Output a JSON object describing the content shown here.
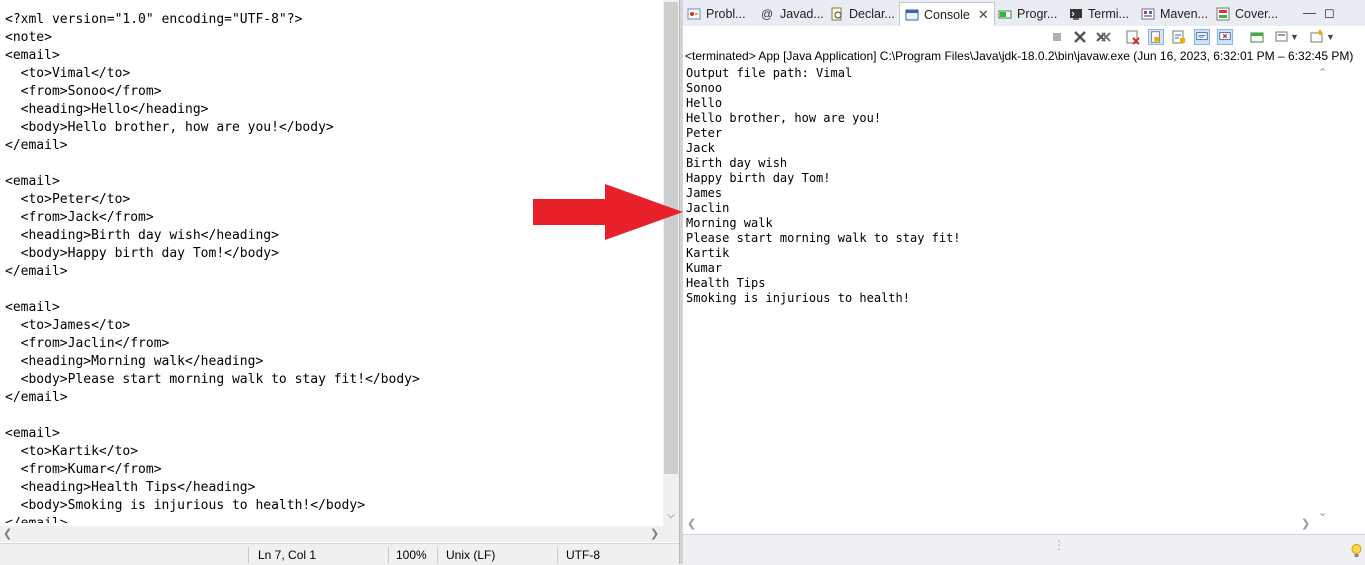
{
  "editor": {
    "lines": [
      "<?xml version=\"1.0\" encoding=\"UTF-8\"?>",
      "<note>",
      "<email>",
      "  <to>Vimal</to>",
      "  <from>Sonoo</from>",
      "  <heading>Hello</heading>",
      "  <body>Hello brother, how are you!</body>",
      "</email>",
      "",
      "<email>",
      "  <to>Peter</to>",
      "  <from>Jack</from>",
      "  <heading>Birth day wish</heading>",
      "  <body>Happy birth day Tom!</body>",
      "</email>",
      "",
      "<email>",
      "  <to>James</to>",
      "  <from>Jaclin</from>",
      "  <heading>Morning walk</heading>",
      "  <body>Please start morning walk to stay fit!</body>",
      "</email>",
      "",
      "<email>",
      "  <to>Kartik</to>",
      "  <from>Kumar</from>",
      "  <heading>Health Tips</heading>",
      "  <body>Smoking is injurious to health!</body>",
      "</email>"
    ],
    "status": {
      "position": "Ln 7, Col 1",
      "zoom": "100%",
      "line_ending": "Unix (LF)",
      "encoding": "UTF-8"
    }
  },
  "eclipse": {
    "tabs": [
      {
        "label": "Probl...",
        "icon": "problems-icon"
      },
      {
        "label": "Javad...",
        "icon": "javadoc-icon"
      },
      {
        "label": "Declar...",
        "icon": "declaration-icon"
      },
      {
        "label": "Console",
        "icon": "console-icon",
        "active": true
      },
      {
        "label": "Progr...",
        "icon": "progress-icon"
      },
      {
        "label": "Termi...",
        "icon": "terminal-icon"
      },
      {
        "label": "Maven...",
        "icon": "maven-icon"
      },
      {
        "label": "Cover...",
        "icon": "coverage-icon"
      }
    ],
    "console_header": "<terminated> App [Java Application] C:\\Program Files\\Java\\jdk-18.0.2\\bin\\javaw.exe  (Jun 16, 2023, 6:32:01 PM – 6:32:45 PM)",
    "output_lines": [
      "Output file path: Vimal",
      "Sonoo",
      "Hello",
      "Hello brother, how are you!",
      "Peter",
      "Jack",
      "Birth day wish",
      "Happy birth day Tom!",
      "James",
      "Jaclin",
      "Morning walk",
      "Please start morning walk to stay fit!",
      "Kartik",
      "Kumar",
      "Health Tips",
      "Smoking is injurious to health!"
    ]
  },
  "colors": {
    "arrow": "#e8202a",
    "tab_bar": "#e9ecf3"
  }
}
